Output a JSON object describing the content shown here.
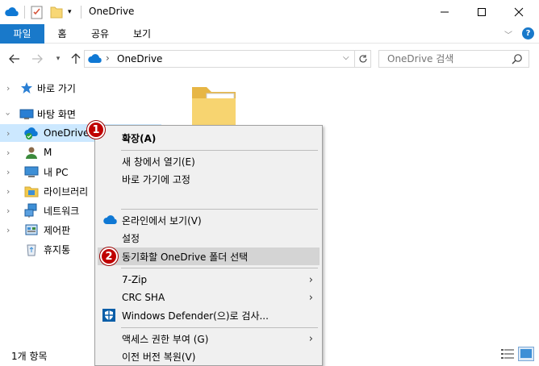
{
  "window": {
    "title": "OneDrive"
  },
  "ribbon": {
    "tabs": [
      "파일",
      "홈",
      "공유",
      "보기"
    ]
  },
  "address": {
    "path": "OneDrive",
    "search_placeholder": "OneDrive 검색"
  },
  "navpane": {
    "items": [
      {
        "label": "바로 가기",
        "icon": "star-icon"
      },
      {
        "label": "바탕 화면",
        "icon": "desktop-icon"
      },
      {
        "label": "OneDrive",
        "icon": "onedrive-icon"
      },
      {
        "label": "M",
        "icon": "user-icon"
      },
      {
        "label": "내 PC",
        "icon": "pc-icon"
      },
      {
        "label": "라이브러리",
        "icon": "library-icon"
      },
      {
        "label": "네트워크",
        "icon": "network-icon"
      },
      {
        "label": "제어판",
        "icon": "control-panel-icon"
      },
      {
        "label": "휴지통",
        "icon": "recycle-bin-icon"
      }
    ]
  },
  "status": {
    "item_count": "1개 항목"
  },
  "context_menu": {
    "expand": "확장(A)",
    "open_new_window": "새 창에서 열기(E)",
    "pin_quick_access": "바로 가기에 고정",
    "view_online": "온라인에서 보기(V)",
    "settings": "설정",
    "choose_folders": "동기화할 OneDrive 폴더 선택",
    "seven_zip": "7-Zip",
    "crc_sha": "CRC SHA",
    "defender": "Windows Defender(으)로 검사...",
    "give_access": "액세스 권한 부여 (G)",
    "restore_versions": "이전 버전 복원(V)"
  },
  "annotations": {
    "step1": "1",
    "step2": "2"
  },
  "colors": {
    "accent": "#1979ca",
    "selection": "#cce8ff",
    "badge": "#c00000"
  }
}
